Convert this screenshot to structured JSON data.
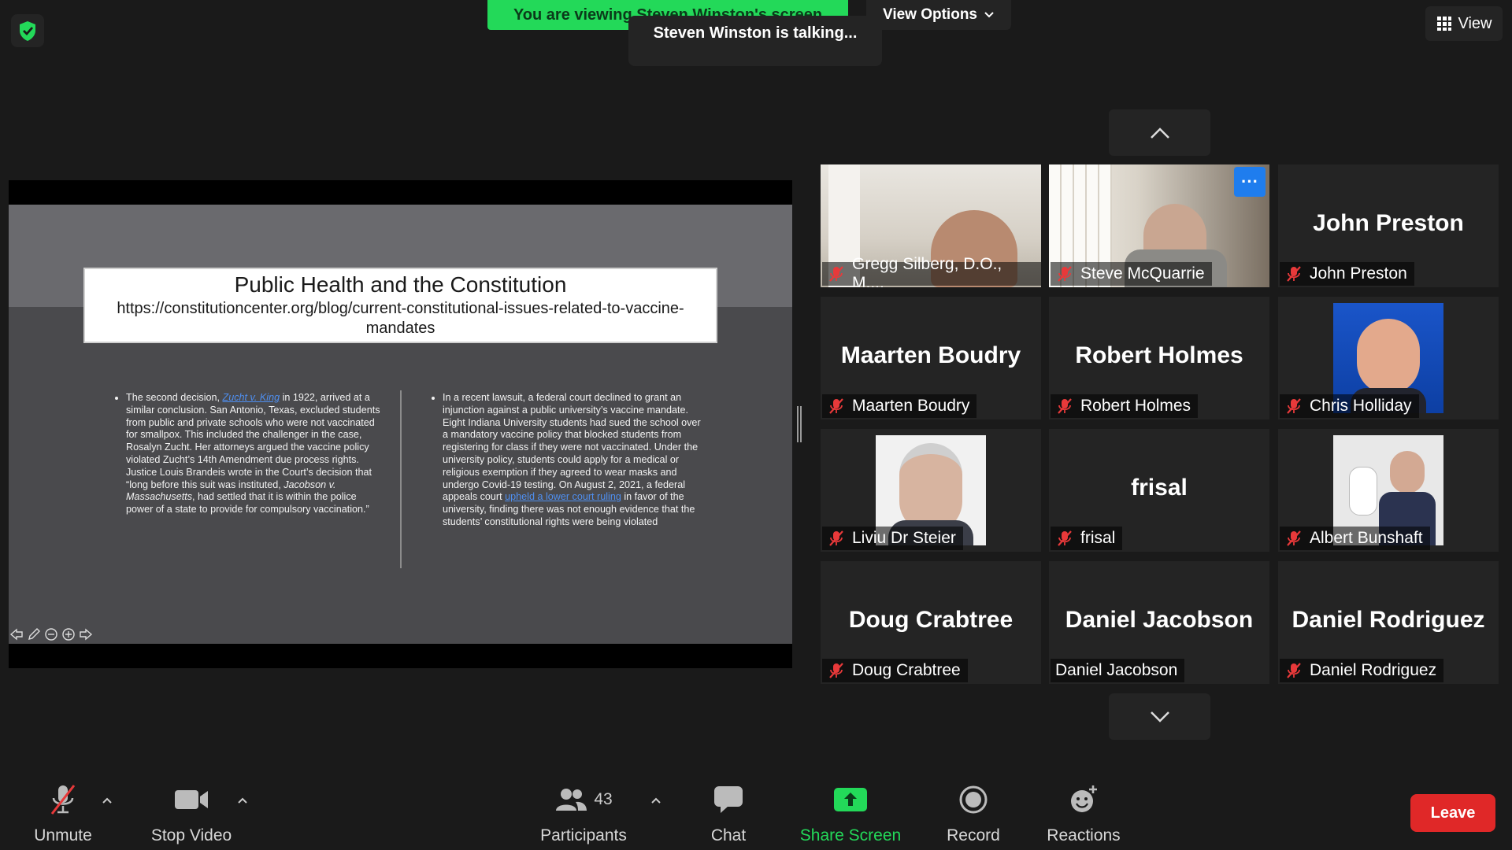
{
  "banner": {
    "viewing": "You are viewing Steven Winston's screen",
    "view_options": "View Options"
  },
  "talking": "Steven Winston is talking...",
  "view_button": "View",
  "slide": {
    "title": "Public Health and the Constitution",
    "url": "https://constitutioncenter.org/blog/current-constitutional-issues-related-to-vaccine-mandates",
    "left": {
      "pre": "The second decision, ",
      "link": "Zucht v. King",
      "post1": " in 1922, arrived at a similar conclusion. San Antonio, Texas, excluded students from public and private schools who were not vaccinated for smallpox. This included the challenger in the case, Rosalyn Zucht. Her attorneys argued the vaccine policy violated Zucht’s 14th Amendment due process rights. Justice Louis Brandeis wrote in the Court’s decision that “long before this suit was instituted, ",
      "italic": "Jacobson v. Massachusetts",
      "post2": ", had settled that it is within the police power of a state to provide for compulsory vaccination.”"
    },
    "right": {
      "pre": "In a recent lawsuit, a federal court declined to grant an injunction against a public university’s vaccine mandate. Eight Indiana University students had sued the school over a mandatory vaccine policy that blocked students from registering for class if they were not vaccinated. Under the university policy, students could apply for a medical or religious exemption if they agreed to wear masks and undergo Covid-19 testing. On August 2, 2021, a federal appeals court ",
      "link": "upheld a lower court ruling",
      "post": " in favor of the university, finding there was not enough evidence that the students’ constitutional rights were being violated"
    }
  },
  "participants": [
    {
      "label": "Gregg Silberg, D.O., M....",
      "muted": true,
      "kind": "video-1"
    },
    {
      "label": "Steve McQuarrie",
      "muted": true,
      "kind": "video-2"
    },
    {
      "label": "John Preston",
      "name": "John Preston",
      "muted": true,
      "kind": "name"
    },
    {
      "label": "Maarten Boudry",
      "name": "Maarten Boudry",
      "muted": true,
      "kind": "name"
    },
    {
      "label": "Robert Holmes",
      "name": "Robert Holmes",
      "muted": true,
      "kind": "name"
    },
    {
      "label": "Chris Holliday",
      "muted": true,
      "kind": "photo-1"
    },
    {
      "label": "Liviu Dr Steier",
      "muted": true,
      "kind": "photo-2"
    },
    {
      "label": "frisal",
      "name": "frisal",
      "muted": true,
      "kind": "name"
    },
    {
      "label": "Albert Bunshaft",
      "muted": true,
      "kind": "photo-3"
    },
    {
      "label": "Doug Crabtree",
      "name": "Doug Crabtree",
      "muted": true,
      "kind": "name"
    },
    {
      "label": "Daniel Jacobson",
      "name": "Daniel Jacobson",
      "muted": false,
      "kind": "name"
    },
    {
      "label": "Daniel Rodriguez",
      "name": "Daniel Rodriguez",
      "muted": true,
      "kind": "name"
    }
  ],
  "toolbar": {
    "unmute": "Unmute",
    "stop_video": "Stop Video",
    "participants": "Participants",
    "participants_count": "43",
    "chat": "Chat",
    "share_screen": "Share Screen",
    "record": "Record",
    "reactions": "Reactions",
    "leave": "Leave"
  },
  "colors": {
    "banner": "#23d959",
    "share_screen": "#23d959",
    "leave": "#e02828",
    "mute": "#e8393a",
    "more": "#1f7dee"
  }
}
